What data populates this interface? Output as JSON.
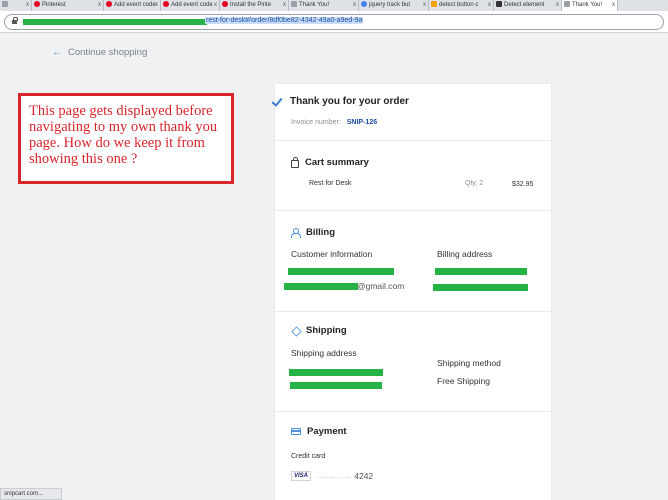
{
  "browser": {
    "tabs": [
      {
        "title": "",
        "icon": "page-icon",
        "color": "#9aa0a6"
      },
      {
        "title": "Pinterest",
        "icon": "pinterest-icon",
        "color": "#e60023"
      },
      {
        "title": "Add event code",
        "icon": "pinterest-icon",
        "color": "#e60023"
      },
      {
        "title": "Add event code",
        "icon": "pinterest-icon",
        "color": "#e60023"
      },
      {
        "title": "Install the Pinte",
        "icon": "pinterest-icon",
        "color": "#e60023"
      },
      {
        "title": "Thank You!",
        "icon": "page-icon",
        "color": "#9aa0a6"
      },
      {
        "title": "jquery track but",
        "icon": "google-icon",
        "color": "#4285f4"
      },
      {
        "title": "detect button c",
        "icon": "page-icon",
        "color": "#f4a300"
      },
      {
        "title": "Detect element",
        "icon": "page-icon",
        "color": "#333333"
      },
      {
        "title": "Thank You!",
        "icon": "page-icon",
        "color": "#9aa0a6"
      }
    ],
    "url_visible": "rest-for-desk#/order/8df0be82-4342-49a0-a9ed-9a",
    "status_text": "snipcart.com..."
  },
  "nav": {
    "continue_label": "Continue shopping"
  },
  "annotation": {
    "text": "This page gets displayed before navigating to my own thank you page. How do we keep it from showing this one ?"
  },
  "order": {
    "title": "Thank you for your order",
    "invoice_label": "Invoice number:",
    "invoice_value": "SNIP-126"
  },
  "cart": {
    "title": "Cart summary",
    "items": [
      {
        "name": "Rest for Desk",
        "qty": "Qty. 2",
        "price": "$32.95"
      }
    ]
  },
  "billing": {
    "title": "Billing",
    "customer_label": "Customer information",
    "customer_email_suffix": "@gmail.com",
    "address_label": "Billing address"
  },
  "shipping": {
    "title": "Shipping",
    "address_label": "Shipping address",
    "method_label": "Shipping method",
    "method_value": "Free Shipping"
  },
  "payment": {
    "title": "Payment",
    "method_label": "Credit card",
    "card_brand": "VISA",
    "card_mask": ".... .... ....",
    "card_last4": "4242"
  },
  "colors": {
    "accent": "#4a90d9",
    "invoice": "#1a4fa3",
    "redaction": "#27b246",
    "annotation": "#d9262c"
  }
}
